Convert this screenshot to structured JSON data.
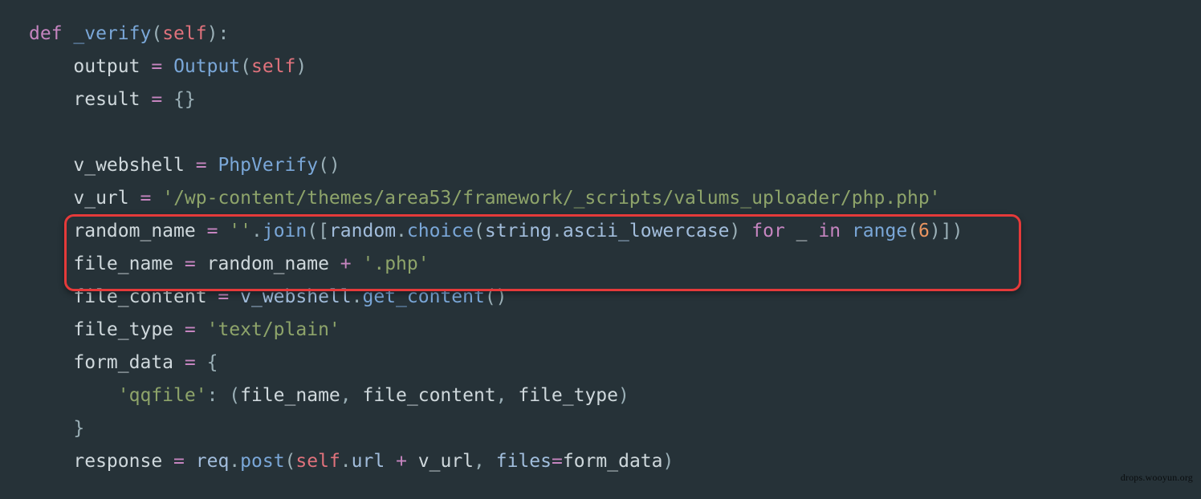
{
  "code": {
    "def": "def",
    "func_name": "_verify",
    "self_kw": "self",
    "output_var": "output",
    "eq": "=",
    "Output": "Output",
    "result_var": "result",
    "empty_braces_open": "{",
    "empty_braces_close": "}",
    "v_webshell": "v_webshell",
    "PhpVerify": "PhpVerify",
    "v_url": "v_url",
    "v_url_val": "'/wp-content/themes/area53/framework/_scripts/valums_uploader/php.php'",
    "random_name": "random_name",
    "empty_str": "''",
    "join": "join",
    "random": "random",
    "choice": "choice",
    "string": "string",
    "ascii_lowercase": "ascii_lowercase",
    "for_kw": "for",
    "underscore": "_",
    "in_kw": "in",
    "range": "range",
    "six": "6",
    "file_name": "file_name",
    "plus": "+",
    "php_ext": "'.php'",
    "file_content": "file_content",
    "get_content": "get_content",
    "file_type": "file_type",
    "text_plain": "'text/plain'",
    "form_data": "form_data",
    "qqfile": "'qqfile'",
    "response": "response",
    "req": "req",
    "post": "post",
    "url_attr": "url",
    "files_kw": "files"
  },
  "watermark": "drops.wooyun.org"
}
